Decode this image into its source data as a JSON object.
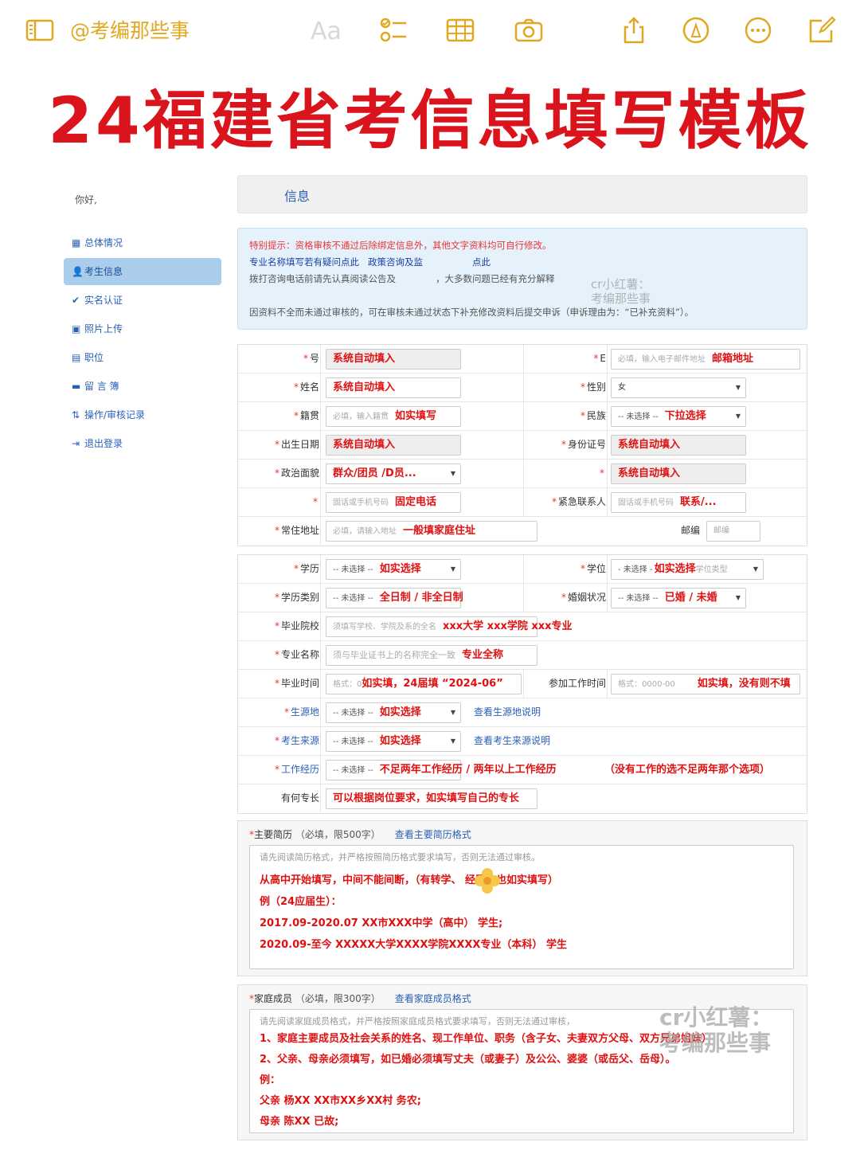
{
  "toolbar": {
    "brand": "@考编那些事",
    "aa": "Aa",
    "icons": [
      "sidebar-icon",
      "checklist-icon",
      "table-icon",
      "camera-icon",
      "share-icon",
      "markup-icon",
      "more-icon",
      "compose-icon"
    ]
  },
  "headline": "24福建省考信息填写模板",
  "sidebar": {
    "greeting": "你好,",
    "items": [
      {
        "label": "总体情况",
        "icon": "grid-icon"
      },
      {
        "label": "考生信息",
        "icon": "user-icon"
      },
      {
        "label": "实名认证",
        "icon": "check-circle-icon"
      },
      {
        "label": "照片上传",
        "icon": "camera-icon"
      },
      {
        "label": "职位",
        "icon": "list-icon"
      },
      {
        "label": "留 言 簿",
        "icon": "comment-icon"
      },
      {
        "label": "操作/审核记录",
        "icon": "sort-icon"
      },
      {
        "label": "退出登录",
        "icon": "logout-icon"
      }
    ]
  },
  "main": {
    "header": "信息",
    "notice": {
      "line1": "特别提示：资格审核不通过后除绑定信息外，其他文字资料均可自行修改。",
      "line2a": "专业名称填写若有疑问点此",
      "line2b": "政策咨询及监",
      "line2c": "点此",
      "line3a": "拨打咨询电话前请先认真阅读公告及",
      "line3b": "，大多数问题已经有充分解释",
      "line5": "因资料不全而未通过审核的，可在审核未通过状态下补充修改资料后提交申诉（申诉理由为：“已补充资料”）。"
    },
    "watermark_small": "cr小红薯：\n考编那些事",
    "watermark_big": "cr小红薯：\n考编那些事"
  },
  "form1": {
    "rows": [
      {
        "l_label": "号",
        "l_hint": "",
        "l_value": "系统自动填入",
        "l_type": "ro",
        "r_label": "E",
        "r_hint": "必填，输入电子邮件地址",
        "r_value": "邮箱地址",
        "r_type": "text"
      },
      {
        "l_label": "姓名",
        "l_hint": "",
        "l_value": "系统自动填入",
        "l_type": "text",
        "r_label": "性别",
        "r_hint": "女",
        "r_value": "",
        "r_type": "select"
      },
      {
        "l_label": "籍贯",
        "l_hint": "必填，输入籍贯",
        "l_value": "如实填写",
        "l_type": "text",
        "r_label": "民族",
        "r_hint": "-- 未选择 --",
        "r_value": "下拉选择",
        "r_type": "select"
      },
      {
        "l_label": "出生日期",
        "l_hint": "",
        "l_value": "系统自动填入",
        "l_type": "ro",
        "r_label": "身份证号",
        "r_hint": "",
        "r_value": "系统自动填入",
        "r_type": "ro"
      },
      {
        "l_label": "政治面貌",
        "l_hint": "",
        "l_value": "群众/团员 /D员...",
        "l_type": "select",
        "r_label": "",
        "r_hint": "",
        "r_value": "系统自动填入",
        "r_type": "ro"
      },
      {
        "l_label": "",
        "l_hint": "固话或手机号码",
        "l_value": "固定电话",
        "l_type": "text",
        "r_label": "紧急联系人",
        "r_hint": "固话或手机号码",
        "r_value": "联系/...",
        "r_type": "text"
      },
      {
        "l_label": "常住地址",
        "l_hint": "必填，请输入地址",
        "l_value": "一般填家庭住址",
        "l_type": "text",
        "r_label": "邮编",
        "r_hint": "邮编",
        "r_value": "",
        "r_type": "text"
      }
    ]
  },
  "form2": {
    "rows": [
      {
        "label": "学历",
        "hint": "-- 未选择 --",
        "value": "如实选择",
        "type": "select",
        "r_label": "学位",
        "r_hint": "- 未选择 -",
        "r_value": "如实选择",
        "r_extra": "学位类型",
        "r_type": "select"
      },
      {
        "label": "学历类别",
        "hint": "-- 未选择 --",
        "value": "全日制 / 非全日制",
        "type": "select",
        "r_label": "婚姻状况",
        "r_hint": "-- 未选择 --",
        "r_value": "已婚 / 未婚",
        "r_type": "select"
      },
      {
        "label": "毕业院校",
        "hint": "须填写学校、学院及系的全名",
        "value": "xxx大学 xxx学院 xxx专业",
        "type": "wide"
      },
      {
        "label": "专业名称",
        "hint": "须与毕业证书上的名称完全一致",
        "value": "专业全称",
        "type": "text"
      },
      {
        "label": "毕业时间",
        "hint": "格式：0",
        "value": "如实填，24届填 “2024-06”",
        "type": "text",
        "r_label": "参加工作时间",
        "r_hint": "格式：0000-00",
        "r_value": "如实填，没有则不填",
        "r_type": "text"
      },
      {
        "label": "生源地",
        "hint": "-- 未选择 --",
        "value": "如实选择",
        "type": "select",
        "link": "查看生源地说明"
      },
      {
        "label": "考生来源",
        "hint": "-- 未选择 --",
        "value": "如实选择",
        "type": "select",
        "link": "查看考生来源说明"
      },
      {
        "label": "工作经历",
        "hint": "-- 未选择 --",
        "value": "不足两年工作经历 / 两年以上工作经历",
        "type": "select",
        "extra": "（没有工作的选不足两年那个选项）"
      },
      {
        "label": "有何专长",
        "hint": "",
        "value": "可以根据岗位要求，如实填写自己的专长",
        "type": "text"
      }
    ]
  },
  "resume": {
    "title": "主要简历",
    "note": "（必填，限500字）",
    "link": "查看主要简历格式",
    "placeholder": "请先阅读简历格式，并严格按照简历格式要求填写，否则无法通过审核。",
    "lines": [
      "从高中开始填写，中间不能间断，（有转学、        经历的也如实填写）",
      "例（24应届生）：",
      "2017.09-2020.07 XX市XXX中学（高中） 学生;",
      "2020.09-至今 XXXXX大学XXXX学院XXXX专业（本科） 学生"
    ]
  },
  "family": {
    "title": "家庭成员",
    "note": "（必填，限300字）",
    "link": "查看家庭成员格式",
    "placeholder": "请先阅读家庭成员格式，并严格按照家庭成员格式要求填写，否则无法通过审核，",
    "lines": [
      "1、家庭主要成员及社会关系的姓名、现工作单位、职务（含子女、夫妻双方父母、双方兄弟姐妹）",
      "2、父亲、母亲必须填写，如已婚必须填写丈夫（或妻子）及公公、婆婆（或岳父、岳母）。",
      "例：",
      "父亲 杨XX XX市XX乡XX村 务农;",
      "母亲 陈XX 已故;"
    ]
  }
}
